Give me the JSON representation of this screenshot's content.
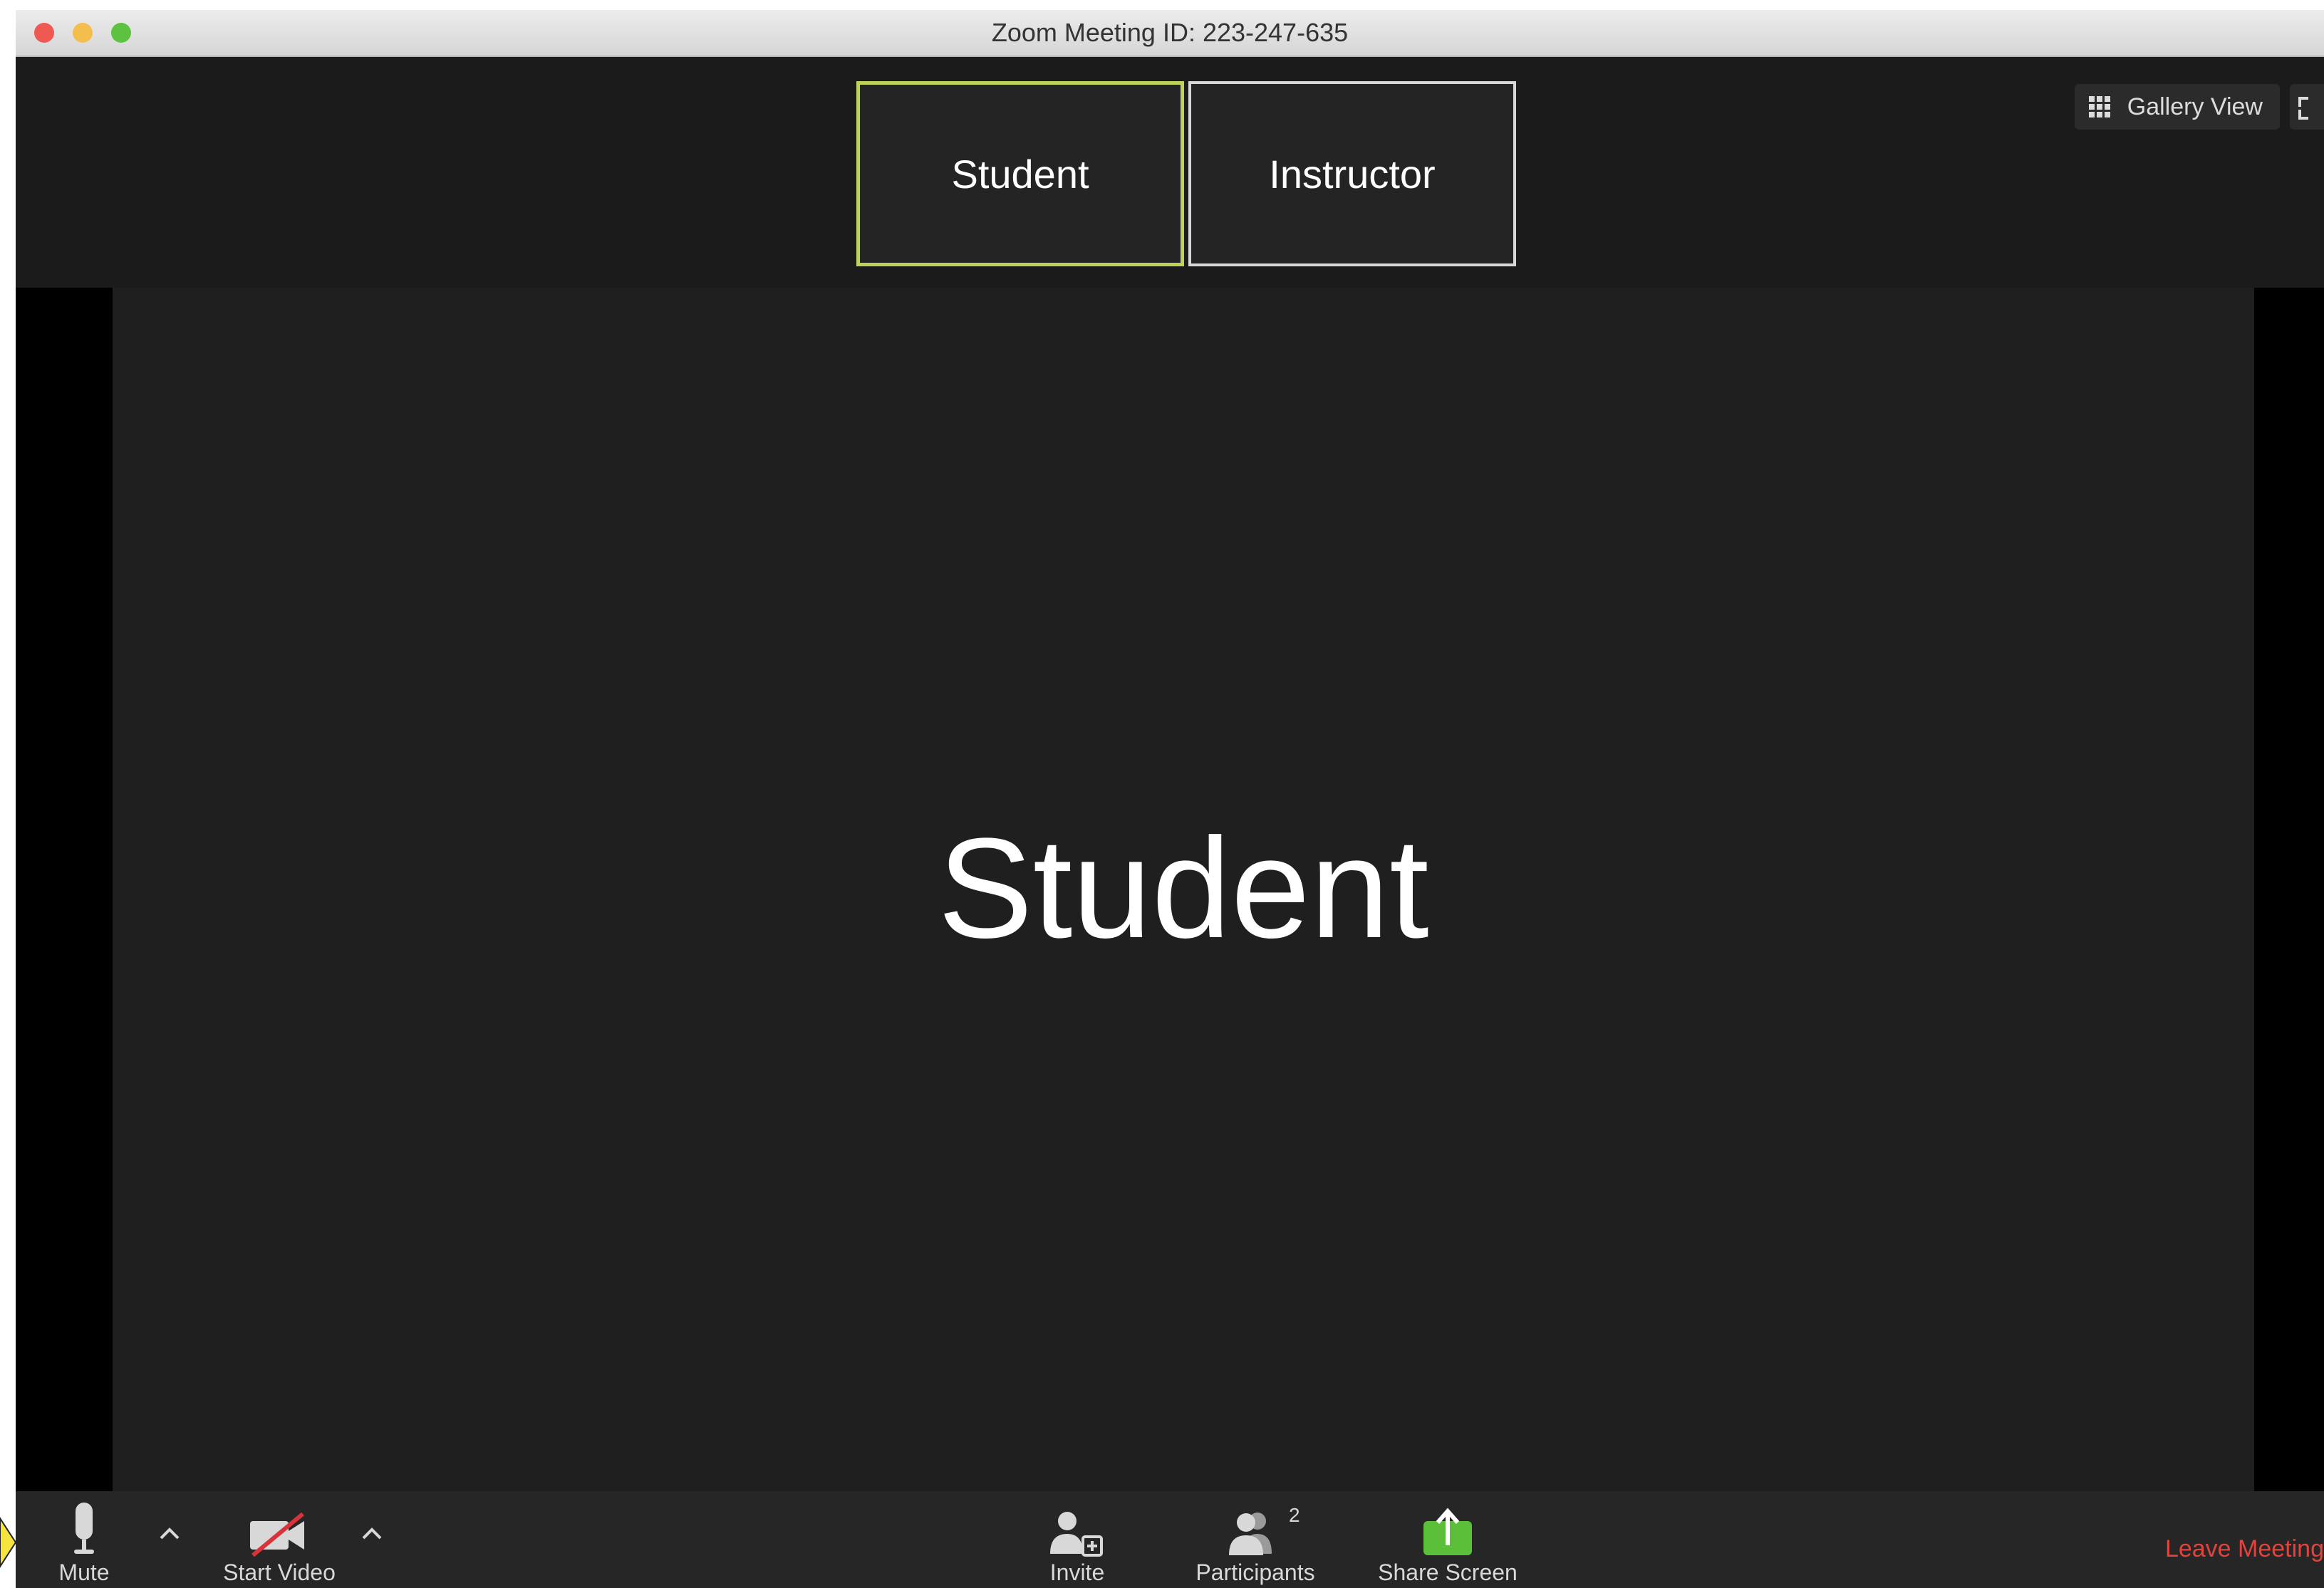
{
  "window": {
    "title": "Zoom Meeting ID: 223-247-635"
  },
  "thumbnails": [
    {
      "name": "Student",
      "active": true
    },
    {
      "name": "Instructor",
      "active": false
    }
  ],
  "view_controls": {
    "gallery_label": "Gallery View"
  },
  "main_video": {
    "speaker_name": "Student"
  },
  "toolbar": {
    "mute_label": "Mute",
    "start_video_label": "Start Video",
    "invite_label": "Invite",
    "participants_label": "Participants",
    "participants_count": "2",
    "share_screen_label": "Share Screen",
    "leave_label": "Leave Meeting"
  },
  "colors": {
    "active_speaker_border": "#bdd35a",
    "share_green": "#5cbf3a",
    "leave_red": "#e0443c"
  }
}
